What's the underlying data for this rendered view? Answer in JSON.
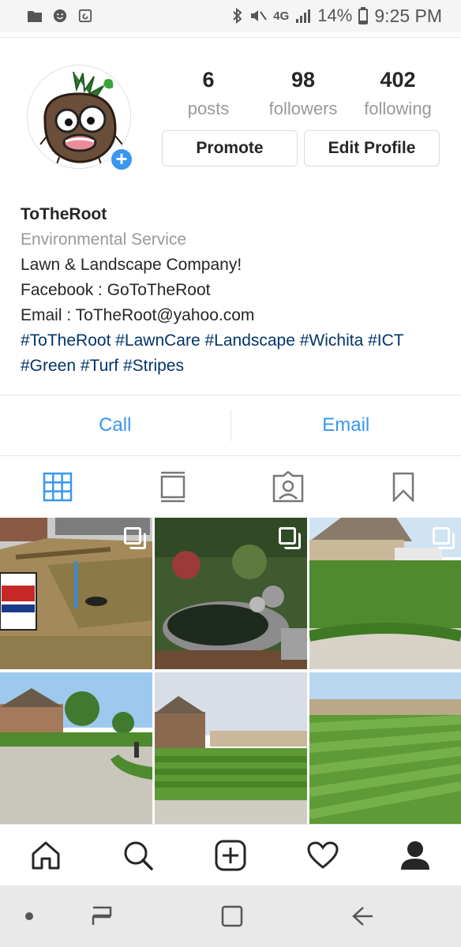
{
  "status_bar": {
    "battery": "14%",
    "time": "9:25 PM",
    "network": "4G"
  },
  "profile": {
    "posts_count": "6",
    "posts_label": "posts",
    "followers_count": "98",
    "followers_label": "followers",
    "following_count": "402",
    "following_label": "following",
    "promote_label": "Promote",
    "edit_label": "Edit Profile"
  },
  "bio": {
    "name": "ToTheRoot",
    "category": "Environmental Service",
    "line1": "Lawn & Landscape Company!",
    "line2": "Facebook : GoToTheRoot",
    "line3": "Email : ToTheRoot@yahoo.com",
    "tags1": "#ToTheRoot #LawnCare #Landscape #Wichita #ICT",
    "tags2": "#Green #Turf #Stripes"
  },
  "contact": {
    "call_label": "Call",
    "email_label": "Email"
  },
  "colors": {
    "accent": "#3897f0",
    "hashtag": "#003569",
    "muted": "#999999"
  },
  "grid_posts": [
    {
      "type": "multi",
      "subject": "yard sign dirt lawn"
    },
    {
      "type": "multi",
      "subject": "garden pond"
    },
    {
      "type": "multi",
      "subject": "house lawn truck"
    },
    {
      "type": "single",
      "subject": "street houses"
    },
    {
      "type": "single",
      "subject": "striped lawn house"
    },
    {
      "type": "single",
      "subject": "striped lawn field"
    }
  ],
  "icons": {
    "tabs": [
      "grid-icon",
      "feed-icon",
      "tagged-icon",
      "saved-icon"
    ],
    "nav": [
      "home-icon",
      "search-icon",
      "add-icon",
      "heart-icon",
      "profile-icon"
    ]
  }
}
